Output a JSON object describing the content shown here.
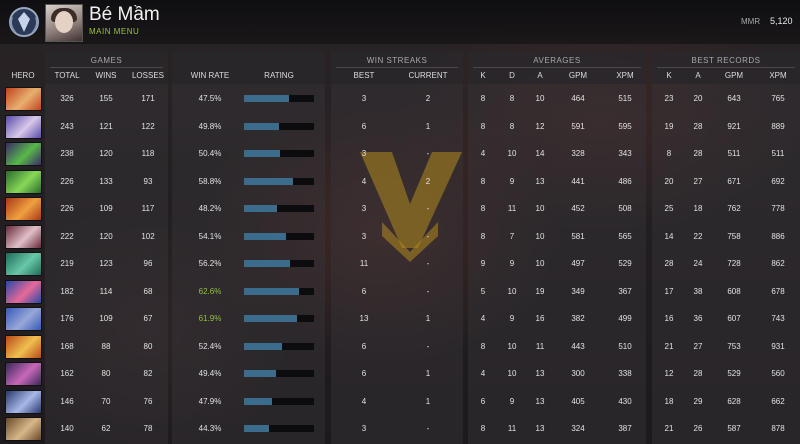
{
  "header": {
    "player_name": "Bé Mầm",
    "subtitle": "MAIN MENU",
    "mmr_label": "MMR",
    "mmr_value": "5,120"
  },
  "groups": {
    "games": "GAMES",
    "win_streaks": "WIN STREAKS",
    "averages": "AVERAGES",
    "best_records": "BEST RECORDS"
  },
  "columns": {
    "hero": "HERO",
    "total": "TOTAL",
    "wins": "WINS",
    "losses": "LOSSES",
    "win_rate": "WIN RATE",
    "rating": "RATING",
    "best": "BEST",
    "current": "CURRENT",
    "k": "K",
    "d": "D",
    "a": "A",
    "gpm": "GPM",
    "xpm": "XPM",
    "rk": "K",
    "ra": "A",
    "rgpm": "GPM",
    "rxpm": "XPM"
  },
  "colors": {
    "win_rate_high": "#8fc43a",
    "win_rate_normal": "#e2e2e2",
    "rating_bar": "#3c6c8c",
    "accent_green": "#9bc43a",
    "watermark_gold": "#b08a1e"
  },
  "rows": [
    {
      "total": "326",
      "wins": "155",
      "losses": "171",
      "win_rate": "47.5%",
      "rating": 0.64,
      "best": "3",
      "current": "2",
      "k": "8",
      "d": "8",
      "a": "10",
      "gpm": "464",
      "xpm": "515",
      "rk": "23",
      "ra": "20",
      "rgpm": "643",
      "rxpm": "765",
      "portrait": [
        "#c0441c",
        "#e8b070"
      ]
    },
    {
      "total": "243",
      "wins": "121",
      "losses": "122",
      "win_rate": "49.8%",
      "rating": 0.5,
      "best": "6",
      "current": "1",
      "k": "8",
      "d": "8",
      "a": "12",
      "gpm": "591",
      "xpm": "595",
      "rk": "19",
      "ra": "28",
      "rgpm": "921",
      "rxpm": "889",
      "portrait": [
        "#5a4aa8",
        "#d8c8e8"
      ]
    },
    {
      "total": "238",
      "wins": "120",
      "losses": "118",
      "win_rate": "50.4%",
      "rating": 0.52,
      "best": "3",
      "current": "-",
      "k": "4",
      "d": "10",
      "a": "14",
      "gpm": "328",
      "xpm": "343",
      "rk": "8",
      "ra": "28",
      "rgpm": "511",
      "rxpm": "511",
      "portrait": [
        "#3a2a6a",
        "#58b848"
      ]
    },
    {
      "total": "226",
      "wins": "133",
      "losses": "93",
      "win_rate": "58.8%",
      "rating": 0.7,
      "best": "4",
      "current": "2",
      "k": "8",
      "d": "9",
      "a": "13",
      "gpm": "441",
      "xpm": "486",
      "rk": "20",
      "ra": "27",
      "rgpm": "671",
      "rxpm": "692",
      "portrait": [
        "#2a6a2a",
        "#88d858"
      ]
    },
    {
      "total": "226",
      "wins": "109",
      "losses": "117",
      "win_rate": "48.2%",
      "rating": 0.47,
      "best": "3",
      "current": "-",
      "k": "8",
      "d": "11",
      "a": "10",
      "gpm": "452",
      "xpm": "508",
      "rk": "25",
      "ra": "18",
      "rgpm": "762",
      "rxpm": "778",
      "portrait": [
        "#a83818",
        "#f0a040"
      ]
    },
    {
      "total": "222",
      "wins": "120",
      "losses": "102",
      "win_rate": "54.1%",
      "rating": 0.6,
      "best": "3",
      "current": "-",
      "k": "8",
      "d": "7",
      "a": "10",
      "gpm": "581",
      "xpm": "565",
      "rk": "14",
      "ra": "22",
      "rgpm": "758",
      "rxpm": "886",
      "portrait": [
        "#682838",
        "#e0c0c8"
      ]
    },
    {
      "total": "219",
      "wins": "123",
      "losses": "96",
      "win_rate": "56.2%",
      "rating": 0.65,
      "best": "11",
      "current": "-",
      "k": "9",
      "d": "9",
      "a": "10",
      "gpm": "497",
      "xpm": "529",
      "rk": "28",
      "ra": "24",
      "rgpm": "728",
      "rxpm": "862",
      "portrait": [
        "#1e6a5a",
        "#68c8a8"
      ]
    },
    {
      "total": "182",
      "wins": "114",
      "losses": "68",
      "win_rate": "62.6%",
      "rating": 0.78,
      "best": "6",
      "current": "-",
      "k": "5",
      "d": "10",
      "a": "19",
      "gpm": "349",
      "xpm": "367",
      "rk": "17",
      "ra": "38",
      "rgpm": "608",
      "rxpm": "678",
      "portrait": [
        "#2848a8",
        "#e86898"
      ]
    },
    {
      "total": "176",
      "wins": "109",
      "losses": "67",
      "win_rate": "61.9%",
      "rating": 0.76,
      "best": "13",
      "current": "1",
      "k": "4",
      "d": "9",
      "a": "16",
      "gpm": "382",
      "xpm": "499",
      "rk": "16",
      "ra": "36",
      "rgpm": "607",
      "rxpm": "743",
      "portrait": [
        "#3858b8",
        "#98a8d8"
      ]
    },
    {
      "total": "168",
      "wins": "88",
      "losses": "80",
      "win_rate": "52.4%",
      "rating": 0.54,
      "best": "6",
      "current": "-",
      "k": "8",
      "d": "10",
      "a": "11",
      "gpm": "443",
      "xpm": "510",
      "rk": "21",
      "ra": "27",
      "rgpm": "753",
      "rxpm": "931",
      "portrait": [
        "#b84818",
        "#f0c050"
      ]
    },
    {
      "total": "162",
      "wins": "80",
      "losses": "82",
      "win_rate": "49.4%",
      "rating": 0.45,
      "best": "6",
      "current": "1",
      "k": "4",
      "d": "10",
      "a": "13",
      "gpm": "300",
      "xpm": "338",
      "rk": "12",
      "ra": "28",
      "rgpm": "529",
      "rxpm": "560",
      "portrait": [
        "#3a2858",
        "#c868b8"
      ]
    },
    {
      "total": "146",
      "wins": "70",
      "losses": "76",
      "win_rate": "47.9%",
      "rating": 0.4,
      "best": "4",
      "current": "1",
      "k": "6",
      "d": "9",
      "a": "13",
      "gpm": "405",
      "xpm": "430",
      "rk": "18",
      "ra": "29",
      "rgpm": "628",
      "rxpm": "662",
      "portrait": [
        "#283870",
        "#a8b8e8"
      ]
    },
    {
      "total": "140",
      "wins": "62",
      "losses": "78",
      "win_rate": "44.3%",
      "rating": 0.36,
      "best": "3",
      "current": "-",
      "k": "8",
      "d": "11",
      "a": "13",
      "gpm": "324",
      "xpm": "387",
      "rk": "21",
      "ra": "26",
      "rgpm": "587",
      "rxpm": "878",
      "portrait": [
        "#684828",
        "#d8b888"
      ]
    }
  ]
}
